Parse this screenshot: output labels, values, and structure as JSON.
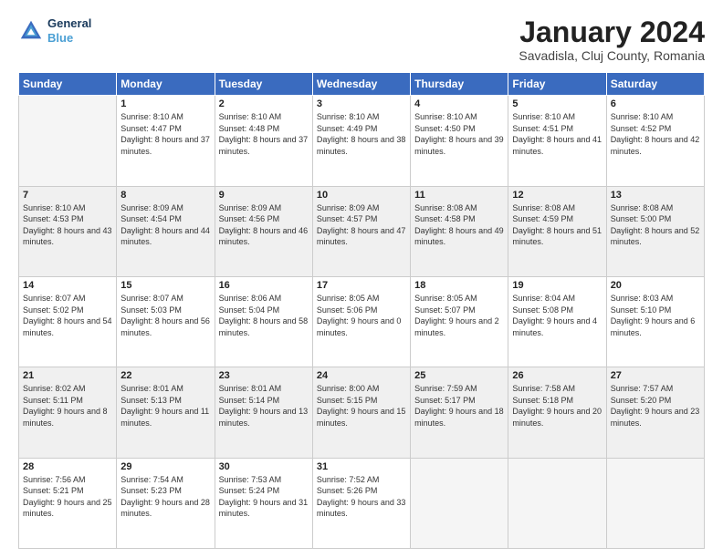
{
  "logo": {
    "line1": "General",
    "line2": "Blue"
  },
  "title": "January 2024",
  "subtitle": "Savadisla, Cluj County, Romania",
  "weekdays": [
    "Sunday",
    "Monday",
    "Tuesday",
    "Wednesday",
    "Thursday",
    "Friday",
    "Saturday"
  ],
  "weeks": [
    [
      {
        "day": "",
        "empty": true
      },
      {
        "day": "1",
        "sunrise": "8:10 AM",
        "sunset": "4:47 PM",
        "daylight": "8 hours and 37 minutes."
      },
      {
        "day": "2",
        "sunrise": "8:10 AM",
        "sunset": "4:48 PM",
        "daylight": "8 hours and 37 minutes."
      },
      {
        "day": "3",
        "sunrise": "8:10 AM",
        "sunset": "4:49 PM",
        "daylight": "8 hours and 38 minutes."
      },
      {
        "day": "4",
        "sunrise": "8:10 AM",
        "sunset": "4:50 PM",
        "daylight": "8 hours and 39 minutes."
      },
      {
        "day": "5",
        "sunrise": "8:10 AM",
        "sunset": "4:51 PM",
        "daylight": "8 hours and 41 minutes."
      },
      {
        "day": "6",
        "sunrise": "8:10 AM",
        "sunset": "4:52 PM",
        "daylight": "8 hours and 42 minutes."
      }
    ],
    [
      {
        "day": "7",
        "sunrise": "8:10 AM",
        "sunset": "4:53 PM",
        "daylight": "8 hours and 43 minutes."
      },
      {
        "day": "8",
        "sunrise": "8:09 AM",
        "sunset": "4:54 PM",
        "daylight": "8 hours and 44 minutes."
      },
      {
        "day": "9",
        "sunrise": "8:09 AM",
        "sunset": "4:56 PM",
        "daylight": "8 hours and 46 minutes."
      },
      {
        "day": "10",
        "sunrise": "8:09 AM",
        "sunset": "4:57 PM",
        "daylight": "8 hours and 47 minutes."
      },
      {
        "day": "11",
        "sunrise": "8:08 AM",
        "sunset": "4:58 PM",
        "daylight": "8 hours and 49 minutes."
      },
      {
        "day": "12",
        "sunrise": "8:08 AM",
        "sunset": "4:59 PM",
        "daylight": "8 hours and 51 minutes."
      },
      {
        "day": "13",
        "sunrise": "8:08 AM",
        "sunset": "5:00 PM",
        "daylight": "8 hours and 52 minutes."
      }
    ],
    [
      {
        "day": "14",
        "sunrise": "8:07 AM",
        "sunset": "5:02 PM",
        "daylight": "8 hours and 54 minutes."
      },
      {
        "day": "15",
        "sunrise": "8:07 AM",
        "sunset": "5:03 PM",
        "daylight": "8 hours and 56 minutes."
      },
      {
        "day": "16",
        "sunrise": "8:06 AM",
        "sunset": "5:04 PM",
        "daylight": "8 hours and 58 minutes."
      },
      {
        "day": "17",
        "sunrise": "8:05 AM",
        "sunset": "5:06 PM",
        "daylight": "9 hours and 0 minutes."
      },
      {
        "day": "18",
        "sunrise": "8:05 AM",
        "sunset": "5:07 PM",
        "daylight": "9 hours and 2 minutes."
      },
      {
        "day": "19",
        "sunrise": "8:04 AM",
        "sunset": "5:08 PM",
        "daylight": "9 hours and 4 minutes."
      },
      {
        "day": "20",
        "sunrise": "8:03 AM",
        "sunset": "5:10 PM",
        "daylight": "9 hours and 6 minutes."
      }
    ],
    [
      {
        "day": "21",
        "sunrise": "8:02 AM",
        "sunset": "5:11 PM",
        "daylight": "9 hours and 8 minutes."
      },
      {
        "day": "22",
        "sunrise": "8:01 AM",
        "sunset": "5:13 PM",
        "daylight": "9 hours and 11 minutes."
      },
      {
        "day": "23",
        "sunrise": "8:01 AM",
        "sunset": "5:14 PM",
        "daylight": "9 hours and 13 minutes."
      },
      {
        "day": "24",
        "sunrise": "8:00 AM",
        "sunset": "5:15 PM",
        "daylight": "9 hours and 15 minutes."
      },
      {
        "day": "25",
        "sunrise": "7:59 AM",
        "sunset": "5:17 PM",
        "daylight": "9 hours and 18 minutes."
      },
      {
        "day": "26",
        "sunrise": "7:58 AM",
        "sunset": "5:18 PM",
        "daylight": "9 hours and 20 minutes."
      },
      {
        "day": "27",
        "sunrise": "7:57 AM",
        "sunset": "5:20 PM",
        "daylight": "9 hours and 23 minutes."
      }
    ],
    [
      {
        "day": "28",
        "sunrise": "7:56 AM",
        "sunset": "5:21 PM",
        "daylight": "9 hours and 25 minutes."
      },
      {
        "day": "29",
        "sunrise": "7:54 AM",
        "sunset": "5:23 PM",
        "daylight": "9 hours and 28 minutes."
      },
      {
        "day": "30",
        "sunrise": "7:53 AM",
        "sunset": "5:24 PM",
        "daylight": "9 hours and 31 minutes."
      },
      {
        "day": "31",
        "sunrise": "7:52 AM",
        "sunset": "5:26 PM",
        "daylight": "9 hours and 33 minutes."
      },
      {
        "day": "",
        "empty": true
      },
      {
        "day": "",
        "empty": true
      },
      {
        "day": "",
        "empty": true
      }
    ]
  ]
}
